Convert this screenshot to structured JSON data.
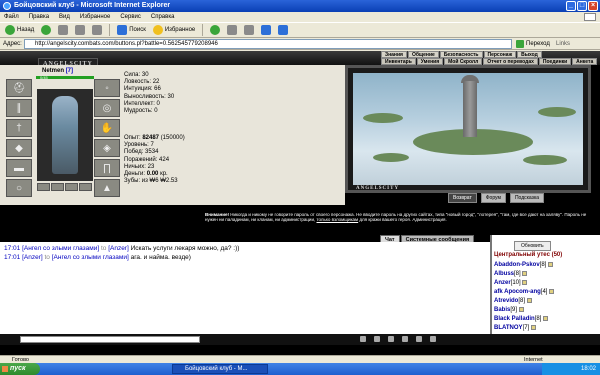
{
  "window": {
    "title": "Бойцовский клуб - Microsoft Internet Explorer"
  },
  "menu": [
    "Файл",
    "Правка",
    "Вид",
    "Избранное",
    "Сервис",
    "Справка"
  ],
  "toolbar": {
    "back": "Назад",
    "search": "Поиск",
    "favorites": "Избранное"
  },
  "address": {
    "label": "Адрес:",
    "url": "http://angelscity.combats.com/buttons.pl?battle=0.562545779208946",
    "go": "Переход",
    "links": "Links"
  },
  "game": {
    "logo": "ANGELSCITY",
    "nav_top": [
      "Знания",
      "Общение",
      "Безопасность",
      "Персонаж",
      "Выход"
    ],
    "nav_bottom": [
      "Инвентарь",
      "Умения",
      "Мой Скролл",
      "Отчет о переводах",
      "Поединки",
      "Анкета"
    ]
  },
  "character": {
    "name": "Netmen",
    "level_tag": "[7]",
    "hp": "0/45",
    "stats": [
      "Сила: 30",
      "Ловкость: 22",
      "Интуиция: 66",
      "Выносливость: 30",
      "Интеллект: 0",
      "Мудрость: 0"
    ],
    "exp_label": "Опыт:",
    "exp_value": "82487",
    "exp_next": "(150000)",
    "level": "Уровень: 7",
    "wins": "Побед: 3534",
    "losses": "Поражений: 424",
    "draws": "Ничьих: 23",
    "money_label": "Деньги:",
    "money_value": "0.00",
    "money_unit": "кр.",
    "teeth": "Зубы: из ₩6 ₩2.53"
  },
  "scene": {
    "label": "ANGELSCITY",
    "buttons": [
      "Возврат",
      "Форум",
      "Подсказка"
    ]
  },
  "warning": {
    "title": "Внимание!",
    "text": "Никогда и никому не говорите пароль от своего персонажа. Не вводите пароль на других сайтах, типа \"новый город\", \"лотерея\", \"там, где все дают на халяву\". Пароль не нужен ни паладинам, ни кланам, ни администрации,",
    "link": "только взломщикам",
    "tail": "для кражи вашего героя.",
    "sign": "Администрация."
  },
  "chat": {
    "tabs": [
      "Чат",
      "Системные сообщения"
    ],
    "messages": [
      {
        "time": "17:01",
        "from": "[Ангел со злыми глазами]",
        "to_word": "to",
        "to": "[Anzer]",
        "text": "Искать услуги лекаря можно, да? :))"
      },
      {
        "time": "17:01",
        "from": "[Anzer]",
        "to_word": "to",
        "to": "[Ангел со злыми глазами]",
        "text": "ага. и найма. везде)"
      }
    ]
  },
  "users": {
    "refresh": "Обновить",
    "room": "Центральный утес (50)",
    "list": [
      {
        "name": "Abaddon-Pskov",
        "lvl": "[8]"
      },
      {
        "name": "Albuss",
        "lvl": "[8]"
      },
      {
        "name": "Anzer",
        "lvl": "[10]"
      },
      {
        "name": "afk Apocom-ang",
        "lvl": "[4]"
      },
      {
        "name": "Atrevido",
        "lvl": "[8]"
      },
      {
        "name": "Babis",
        "lvl": "[9]"
      },
      {
        "name": "Black Palladin",
        "lvl": "[8]"
      },
      {
        "name": "BLATNOY",
        "lvl": "[7]"
      }
    ]
  },
  "statusbar": {
    "left": "Готово",
    "zone": "Internet"
  },
  "taskbar": {
    "start": "пуск",
    "task": "Бойцовский клуб - М...",
    "clock": "18:02"
  }
}
